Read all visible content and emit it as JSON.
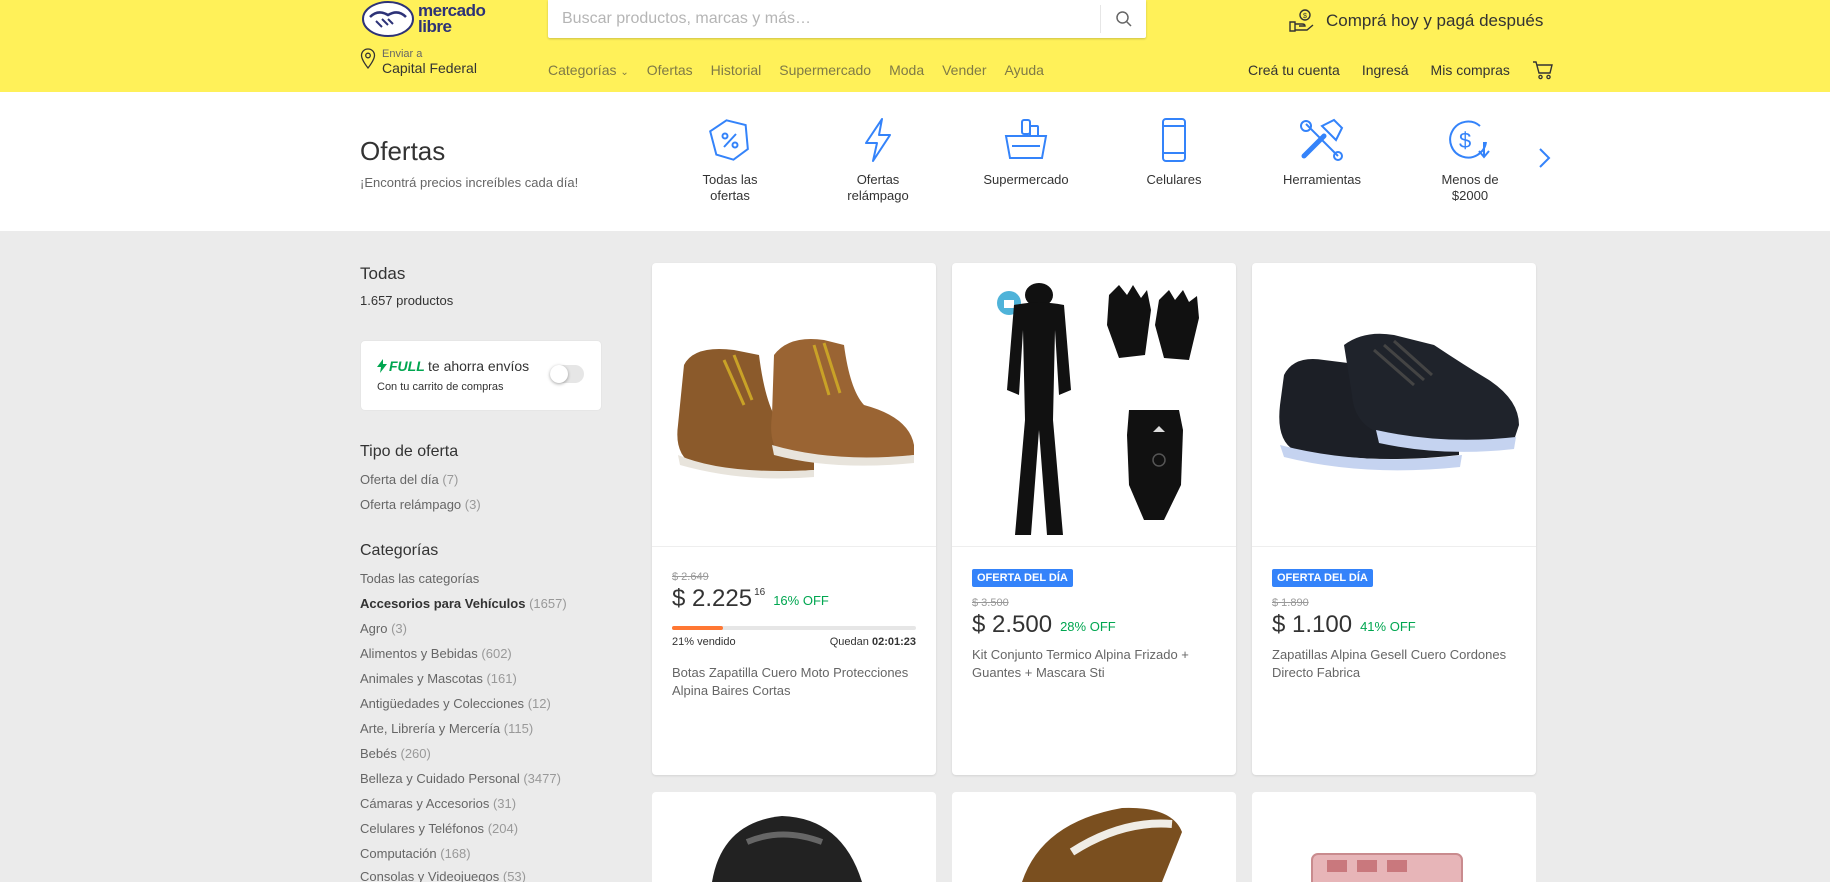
{
  "header": {
    "logo_line1": "mercado",
    "logo_line2": "libre",
    "search_placeholder": "Buscar productos, marcas y más…",
    "promo": "Comprá hoy y pagá después",
    "location_small": "Enviar a",
    "location_big": "Capital Federal",
    "nav": [
      "Categorías",
      "Ofertas",
      "Historial",
      "Supermercado",
      "Moda",
      "Vender",
      "Ayuda"
    ],
    "account": [
      "Creá tu cuenta",
      "Ingresá",
      "Mis compras"
    ]
  },
  "offers": {
    "title": "Ofertas",
    "subtitle": "¡Encontrá precios increíbles cada día!",
    "categories": [
      {
        "label": "Todas las ofertas",
        "icon": "percent-tag-icon"
      },
      {
        "label": "Ofertas relámpago",
        "icon": "lightning-icon"
      },
      {
        "label": "Supermercado",
        "icon": "basket-icon"
      },
      {
        "label": "Celulares",
        "icon": "phone-icon"
      },
      {
        "label": "Herramientas",
        "icon": "tools-icon"
      },
      {
        "label": "Menos de $2000",
        "icon": "dollar-down-icon"
      }
    ]
  },
  "sidebar": {
    "title": "Todas",
    "count": "1.657 productos",
    "full_brand": "FULL",
    "full_text": "te ahorra envíos",
    "full_sub": "Con tu carrito de compras",
    "offer_type_title": "Tipo de oferta",
    "offer_types": [
      {
        "label": "Oferta del día",
        "count": "(7)"
      },
      {
        "label": "Oferta relámpago",
        "count": "(3)"
      }
    ],
    "categories_title": "Categorías",
    "categories": [
      {
        "label": "Todas las categorías",
        "count": ""
      },
      {
        "label": "Accesorios para Vehículos",
        "count": "(1657)"
      },
      {
        "label": "Agro",
        "count": "(3)"
      },
      {
        "label": "Alimentos y Bebidas",
        "count": "(602)"
      },
      {
        "label": "Animales y Mascotas",
        "count": "(161)"
      },
      {
        "label": "Antigüedades y Colecciones",
        "count": "(12)"
      },
      {
        "label": "Arte, Librería y Mercería",
        "count": "(115)"
      },
      {
        "label": "Bebés",
        "count": "(260)"
      },
      {
        "label": "Belleza y Cuidado Personal",
        "count": "(3477)"
      },
      {
        "label": "Cámaras y Accesorios",
        "count": "(31)"
      },
      {
        "label": "Celulares y Teléfonos",
        "count": "(204)"
      },
      {
        "label": "Computación",
        "count": "(168)"
      },
      {
        "label": "Consolas y Videojuegos",
        "count": "(53)"
      }
    ]
  },
  "products": [
    {
      "old_price": "$ 2.649",
      "price": "$ 2.225",
      "cents": "16",
      "off": "16% OFF",
      "badge": "",
      "sold": "21% vendido",
      "sold_fraction": 0.21,
      "remaining_label": "Quedan",
      "remaining_time": "02:01:23",
      "title": "Botas Zapatilla Cuero Moto Protecciones Alpina Baires Cortas"
    },
    {
      "old_price": "$ 3.500",
      "price": "$ 2.500",
      "cents": "",
      "off": "28% OFF",
      "badge": "OFERTA DEL DÍA",
      "title": "Kit Conjunto Termico Alpina Frizado + Guantes + Mascara Sti"
    },
    {
      "old_price": "$ 1.890",
      "price": "$ 1.100",
      "cents": "",
      "off": "41% OFF",
      "badge": "OFERTA DEL DÍA",
      "title": "Zapatillas Alpina Gesell Cuero Cordones Directo Fabrica"
    }
  ],
  "colors": {
    "header_bg": "#fff159",
    "accent_blue": "#3483fa",
    "discount_green": "#00a650",
    "progress_orange": "#ff7733"
  }
}
